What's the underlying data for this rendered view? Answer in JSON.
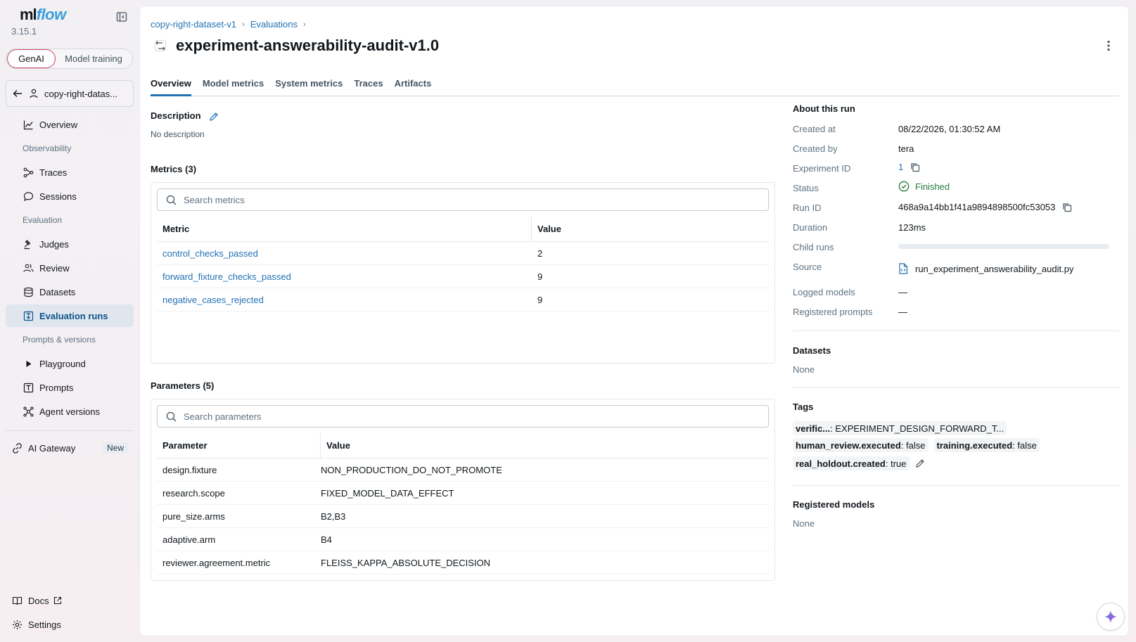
{
  "app": {
    "logo_ml": "ml",
    "logo_flow": "flow",
    "version": "3.15.1"
  },
  "mode_switch": {
    "genai": "GenAI",
    "model_training": "Model training"
  },
  "experiment_selector": {
    "label": "copy-right-datas..."
  },
  "sidebar": {
    "overview": "Overview",
    "section_observability": "Observability",
    "traces": "Traces",
    "sessions": "Sessions",
    "section_evaluation": "Evaluation",
    "judges": "Judges",
    "review": "Review",
    "datasets": "Datasets",
    "evaluation_runs": "Evaluation runs",
    "section_prompts": "Prompts & versions",
    "playground": "Playground",
    "prompts": "Prompts",
    "agent_versions": "Agent versions",
    "ai_gateway": "AI Gateway",
    "new_badge": "New",
    "docs": "Docs",
    "settings": "Settings"
  },
  "breadcrumb": {
    "experiment": "copy-right-dataset-v1",
    "section": "Evaluations"
  },
  "run": {
    "title": "experiment-answerability-audit-v1.0"
  },
  "tabs": [
    "Overview",
    "Model metrics",
    "System metrics",
    "Traces",
    "Artifacts"
  ],
  "description": {
    "heading": "Description",
    "empty": "No description"
  },
  "metrics": {
    "heading": "Metrics (3)",
    "search_placeholder": "Search metrics",
    "col_metric": "Metric",
    "col_value": "Value",
    "rows": [
      {
        "name": "control_checks_passed",
        "value": "2"
      },
      {
        "name": "forward_fixture_checks_passed",
        "value": "9"
      },
      {
        "name": "negative_cases_rejected",
        "value": "9"
      }
    ]
  },
  "parameters": {
    "heading": "Parameters (5)",
    "search_placeholder": "Search parameters",
    "col_param": "Parameter",
    "col_value": "Value",
    "rows": [
      {
        "name": "design.fixture",
        "value": "NON_PRODUCTION_DO_NOT_PROMOTE"
      },
      {
        "name": "research.scope",
        "value": "FIXED_MODEL_DATA_EFFECT"
      },
      {
        "name": "pure_size.arms",
        "value": "B2,B3"
      },
      {
        "name": "adaptive.arm",
        "value": "B4"
      },
      {
        "name": "reviewer.agreement.metric",
        "value": "FLEISS_KAPPA_ABSOLUTE_DECISION"
      }
    ]
  },
  "about": {
    "heading": "About this run",
    "created_at_label": "Created at",
    "created_at": "08/22/2026, 01:30:52 AM",
    "created_by_label": "Created by",
    "created_by": "tera",
    "experiment_id_label": "Experiment ID",
    "experiment_id": "1",
    "status_label": "Status",
    "status": "Finished",
    "run_id_label": "Run ID",
    "run_id": "468a9a14bb1f41a9894898500fc53053",
    "duration_label": "Duration",
    "duration": "123ms",
    "child_runs_label": "Child runs",
    "source_label": "Source",
    "source": "run_experiment_answerability_audit.py",
    "logged_models_label": "Logged models",
    "logged_models": "—",
    "registered_prompts_label": "Registered prompts",
    "registered_prompts": "—"
  },
  "datasets": {
    "heading": "Datasets",
    "value": "None"
  },
  "tags": {
    "heading": "Tags",
    "items": [
      {
        "key": "verific...",
        "value": " : EXPERIMENT_DESIGN_FORWARD_T..."
      },
      {
        "key": "human_review.executed",
        "value": ": false"
      },
      {
        "key": "training.executed",
        "value": ": false"
      },
      {
        "key": "real_holdout.created",
        "value": ": true"
      }
    ]
  },
  "registered_models": {
    "heading": "Registered models",
    "value": "None"
  },
  "colors": {
    "accent": "#2272b4",
    "active_nav_bg": "#dfe6ee",
    "success": "#277c43",
    "genai_border": "#c94663"
  }
}
